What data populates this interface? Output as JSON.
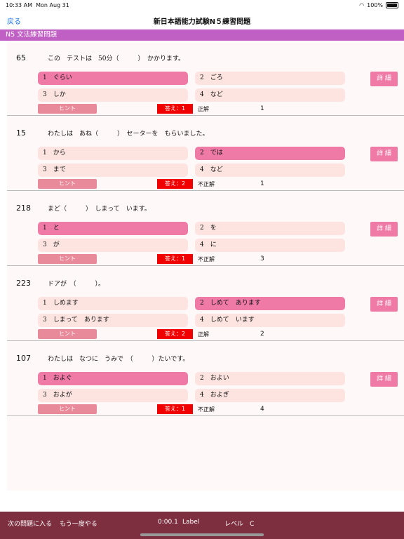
{
  "status": {
    "time": "10:33 AM",
    "date": "Mon Aug 31",
    "battery": "100%"
  },
  "nav": {
    "back": "戻る",
    "title": "新日本語能力試験N５練習問題"
  },
  "section": {
    "title": "N5 文法練習問題"
  },
  "labels": {
    "hint": "ヒント",
    "detail": "詳 細"
  },
  "questions": [
    {
      "num": "65",
      "text": "この　テストは　50分（　　　）　かかります。",
      "options": [
        "1　ぐらい",
        "2　ごろ",
        "3　しか",
        "4　など"
      ],
      "selected": 0,
      "answer": "答え：1",
      "result": "正解",
      "count": "1"
    },
    {
      "num": "15",
      "text": "わたしは　あね（　　　）　セーターを　もらいました。",
      "options": [
        "1　から",
        "2　では",
        "3　まで",
        "4　など"
      ],
      "selected": 1,
      "answer": "答え：2",
      "result": "不正解",
      "count": "1"
    },
    {
      "num": "218",
      "text": "まど（　　　）　しまって　います。",
      "options": [
        "1　と",
        "2　を",
        "3　が",
        "4　に"
      ],
      "selected": 0,
      "answer": "答え：1",
      "result": "不正解",
      "count": "3"
    },
    {
      "num": "223",
      "text": "ドアが　（　　　）。",
      "options": [
        "1　しめます",
        "2　しめて　あります",
        "3　しまって　あります",
        "4　しめて　います"
      ],
      "selected": 1,
      "answer": "答え：2",
      "result": "正解",
      "count": "2"
    },
    {
      "num": "107",
      "text": "わたしは　なつに　うみで　（　　　）たいです。",
      "options": [
        "1　およぐ",
        "2　およい",
        "3　およが",
        "4　およぎ"
      ],
      "selected": 0,
      "answer": "答え：1",
      "result": "不正解",
      "count": "4"
    }
  ],
  "bottom": {
    "next": "次の問題に入る",
    "retry": "もう一度やる",
    "timer": "0:00.1",
    "label": "Label",
    "level": "レベル　C"
  }
}
